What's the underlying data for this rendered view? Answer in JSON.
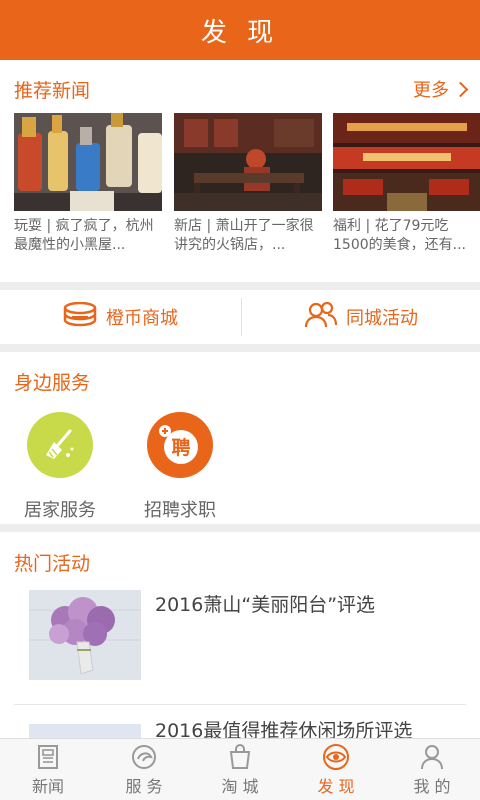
{
  "header": {
    "title": "发 现"
  },
  "news": {
    "title": "推荐新闻",
    "more_label": "更多",
    "items": [
      {
        "text": "玩耍 | 疯了疯了，杭州最魔性的小黑屋..."
      },
      {
        "text": "新店 | 萧山开了一家很讲究的火锅店，..."
      },
      {
        "text": "福利 | 花了79元吃1500的美食，还有..."
      }
    ]
  },
  "quick": {
    "mall_label": "橙币商城",
    "events_label": "同城活动"
  },
  "services": {
    "title": "身边服务",
    "items": [
      {
        "label": "居家服务"
      },
      {
        "label": "招聘求职",
        "badge": "聘"
      }
    ]
  },
  "hot": {
    "title": "热门活动",
    "items": [
      {
        "title": "2016萧山“美丽阳台”评选"
      },
      {
        "title": "2016最值得推荐休闲场所评选"
      }
    ]
  },
  "tabs": [
    {
      "label": "新闻",
      "icon": "news-icon",
      "active": false
    },
    {
      "label": "服 务",
      "icon": "service-icon",
      "active": false
    },
    {
      "label": "淘 城",
      "icon": "shopping-bag-icon",
      "active": false
    },
    {
      "label": "发 现",
      "icon": "discover-eye-icon",
      "active": true
    },
    {
      "label": "我 的",
      "icon": "user-icon",
      "active": false
    }
  ],
  "colors": {
    "accent": "#e8651a",
    "service_green": "#c8d94a",
    "background": "#ededed"
  }
}
